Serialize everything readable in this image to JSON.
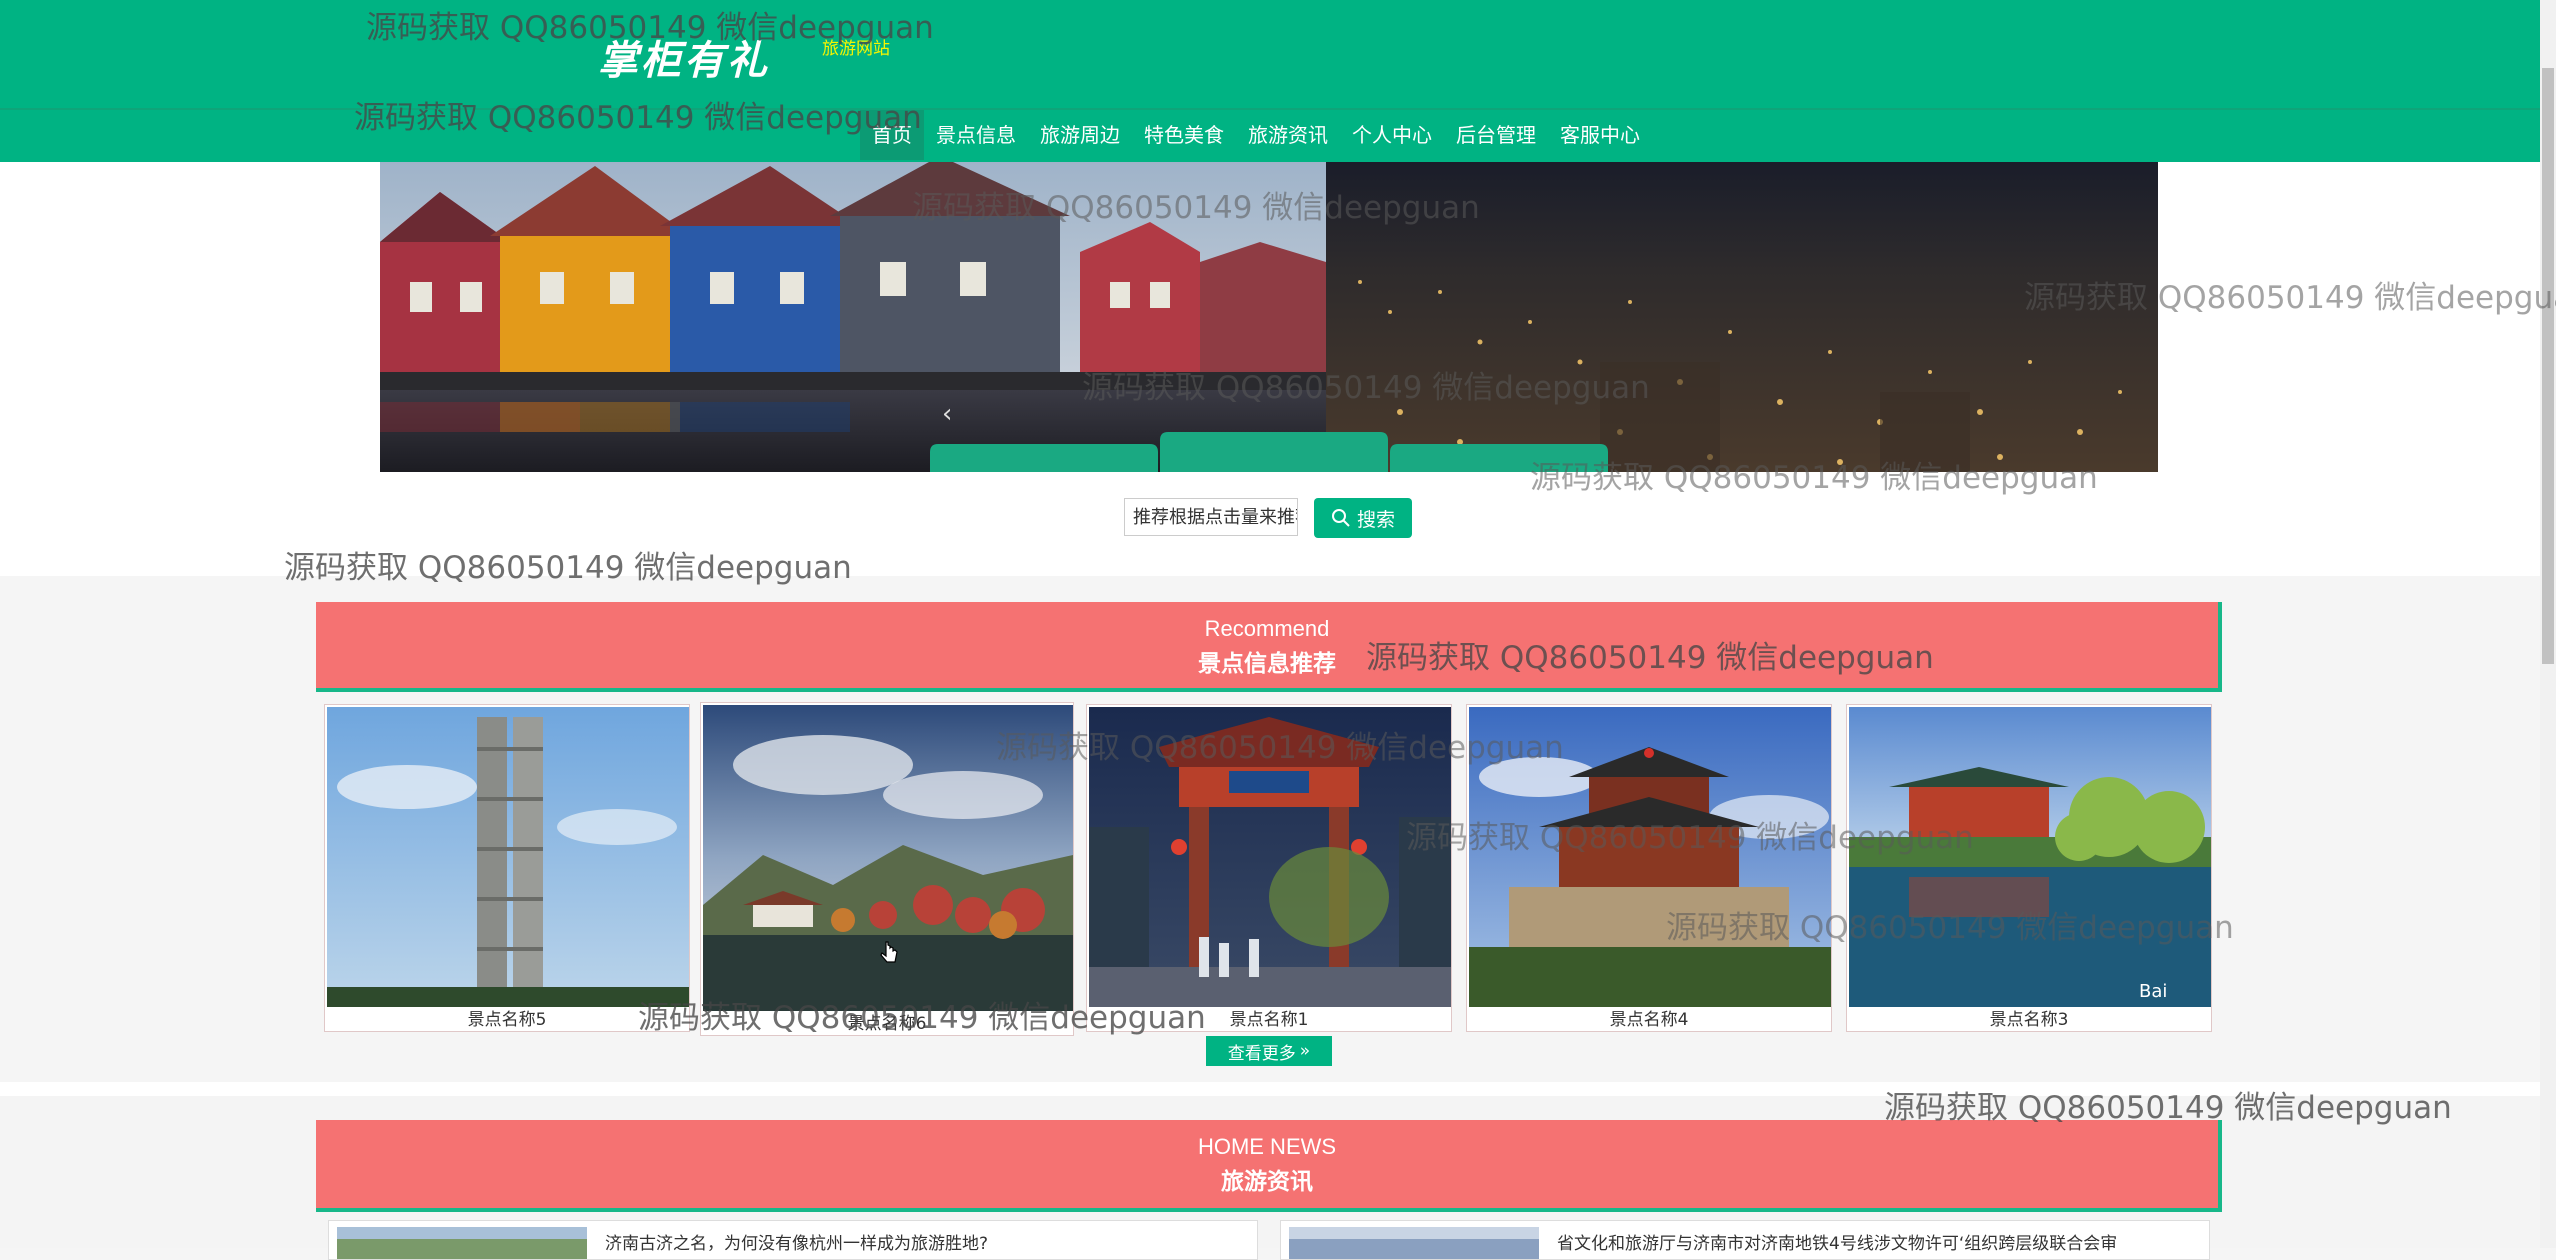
{
  "header": {
    "logo_text": "掌柜有礼",
    "logo_subtitle": "旅游网站",
    "nav": [
      "首页",
      "景点信息",
      "旅游周边",
      "特色美食",
      "旅游资讯",
      "个人中心",
      "后台管理",
      "客服中心"
    ],
    "active_nav": "首页"
  },
  "search": {
    "placeholder": "推荐根据点击量来推荐",
    "button_label": "搜索"
  },
  "recommend": {
    "title_en": "Recommend",
    "title_cn": "景点信息推荐",
    "items": [
      {
        "name": "景点名称5"
      },
      {
        "name": "景点名称6"
      },
      {
        "name": "景点名称1"
      },
      {
        "name": "景点名称4"
      },
      {
        "name": "景点名称3"
      }
    ],
    "more_label": "查看更多"
  },
  "news": {
    "title_en": "HOME NEWS",
    "title_cn": "旅游资讯",
    "items": [
      {
        "title": "济南古济之名，为何没有像杭州一样成为旅游胜地?"
      },
      {
        "title": "省文化和旅游厅与济南市对济南地铁4号线涉文物许可‘组织跨层级联合会审"
      }
    ]
  },
  "watermark": "源码获取 QQ86050149 微信deepguan",
  "colors": {
    "header_green": "#00b383",
    "title_red": "#f57272",
    "accent_green": "#17b789"
  }
}
